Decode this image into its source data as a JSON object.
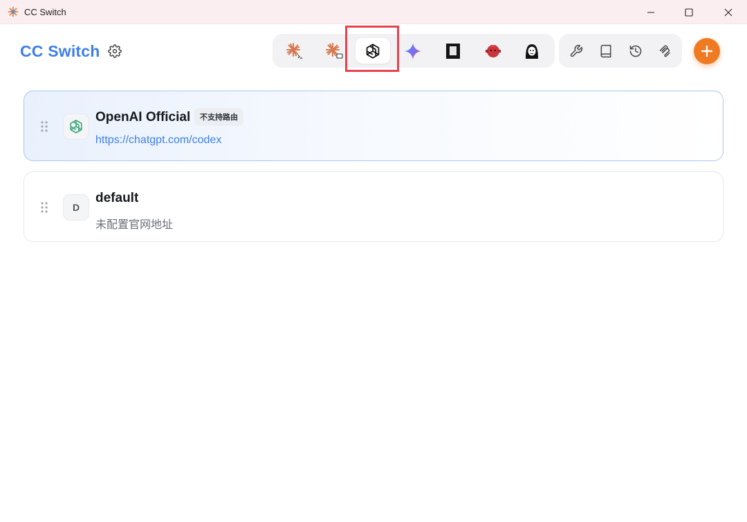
{
  "window": {
    "title": "CC Switch",
    "logo_icon": "cc-switch-logo-icon",
    "controls": [
      "minimize-icon",
      "maximize-icon",
      "close-icon"
    ]
  },
  "header": {
    "title": "CC Switch",
    "settings_icon": "gear-icon",
    "apps": [
      {
        "name": "claude-code",
        "icon": "claude-terminal-icon",
        "active": false
      },
      {
        "name": "claude-desktop",
        "icon": "claude-desktop-icon",
        "active": false
      },
      {
        "name": "codex",
        "icon": "openai-icon",
        "active": true
      },
      {
        "name": "gemini",
        "icon": "gemini-sparkle-icon",
        "active": false
      },
      {
        "name": "opencode",
        "icon": "opencode-icon",
        "active": false
      },
      {
        "name": "droid",
        "icon": "red-droid-icon",
        "active": false
      },
      {
        "name": "agent",
        "icon": "agent-avatar-icon",
        "active": false
      }
    ],
    "tools": [
      {
        "name": "tools",
        "icon": "wrench-icon"
      },
      {
        "name": "prompts",
        "icon": "book-icon"
      },
      {
        "name": "history",
        "icon": "history-icon"
      },
      {
        "name": "mcp",
        "icon": "mcp-icon"
      }
    ],
    "add_icon": "plus-icon"
  },
  "providers": [
    {
      "name": "OpenAI Official",
      "badge": "不支持路由",
      "url": "https://chatgpt.com/codex",
      "icon": "openai-icon",
      "active": true
    },
    {
      "name": "default",
      "badge": "",
      "url": "未配置官网地址",
      "icon_letter": "D",
      "active": false
    }
  ],
  "colors": {
    "accent": "#3d7fe6",
    "add_button": "#f07a22",
    "highlight": "#e8434c",
    "titlebar": "#fbeef1"
  }
}
